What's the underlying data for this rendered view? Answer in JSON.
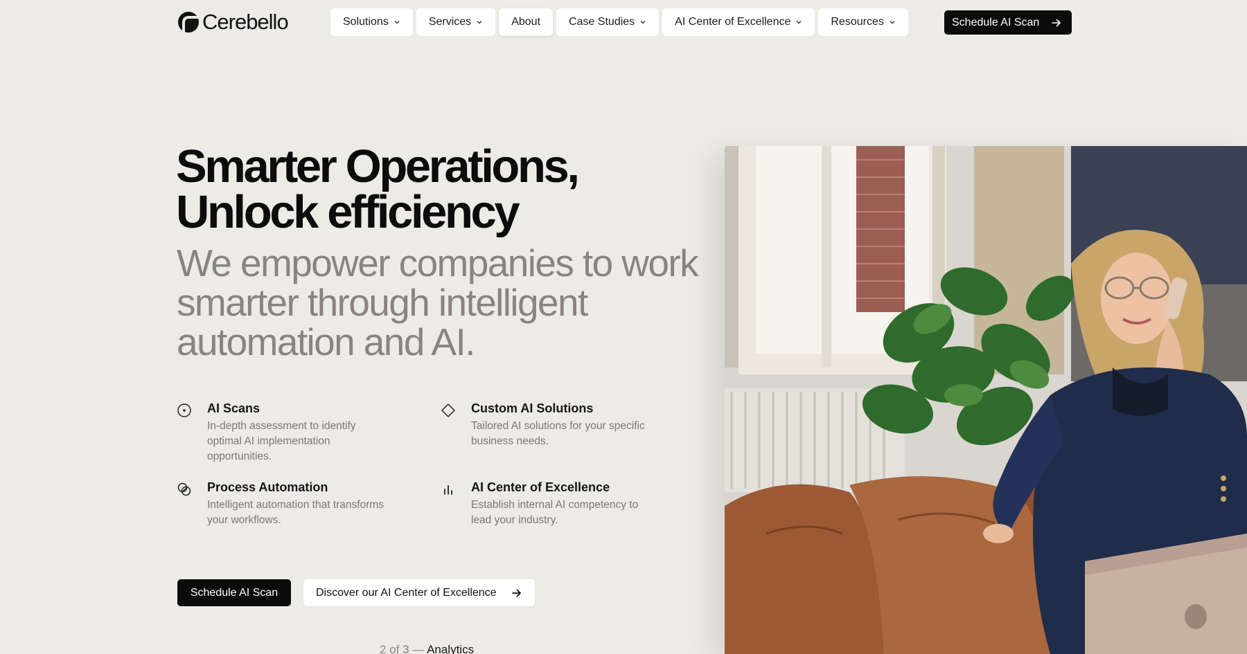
{
  "brand": {
    "name": "Cerebello"
  },
  "nav": {
    "items": [
      {
        "label": "Solutions",
        "has_dropdown": true
      },
      {
        "label": "Services",
        "has_dropdown": true
      },
      {
        "label": "About",
        "has_dropdown": false
      },
      {
        "label": "Case Studies",
        "has_dropdown": true
      },
      {
        "label": "AI Center of Excellence",
        "has_dropdown": true
      },
      {
        "label": "Resources",
        "has_dropdown": true
      }
    ],
    "cta_label": "Schedule AI Scan"
  },
  "hero": {
    "headline_line1": "Smarter Operations,",
    "headline_line2": "Unlock efficiency",
    "subhead": "We empower companies to work smarter through intelligent automation and AI.",
    "features": [
      {
        "icon": "target-icon",
        "title": "AI Scans",
        "description": "In-depth assessment to identify optimal AI implementation opportunities."
      },
      {
        "icon": "diamond-icon",
        "title": "Custom AI Solutions",
        "description": "Tailored AI solutions for your specific business needs."
      },
      {
        "icon": "linked-circles-icon",
        "title": "Process Automation",
        "description": "Intelligent automation that transforms your workflows."
      },
      {
        "icon": "bar-chart-icon",
        "title": "AI Center of Excellence",
        "description": "Establish internal AI competency to lead your industry."
      }
    ],
    "primary_button": "Schedule AI Scan",
    "secondary_button": "Discover our AI Center of Excellence",
    "slide_indicator": {
      "position": "2 of 3 —",
      "label": "Analytics"
    }
  },
  "colors": {
    "background": "#edebe6",
    "text_dark": "#0c0c0c",
    "text_muted": "#8a847d",
    "button_dark": "#0b0b0b",
    "button_light": "#ffffff"
  }
}
